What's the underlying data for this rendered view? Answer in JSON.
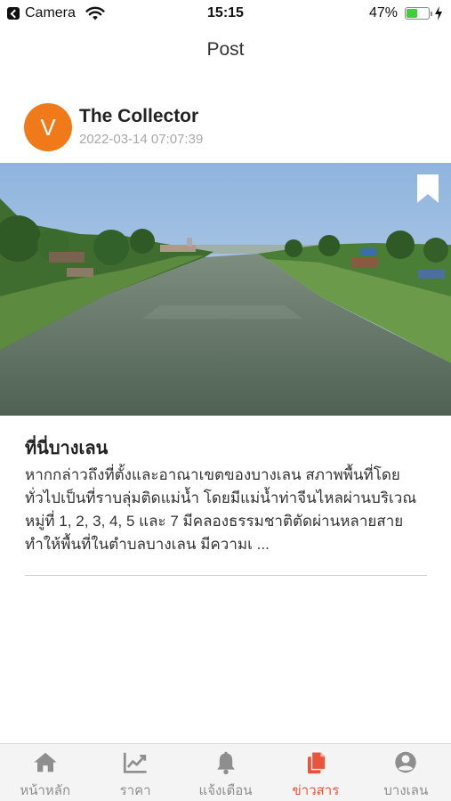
{
  "status_bar": {
    "back_app": "Camera",
    "time": "15:15",
    "battery_percent": "47%",
    "battery_level": 0.47
  },
  "header": {
    "title": "Post"
  },
  "post": {
    "author_initial": "V",
    "author_name": "The Collector",
    "date": "2022-03-14 07:07:39",
    "title": "ที่นี่บางเลน",
    "excerpt": "หากกล่าวถึงที่ตั้งและอาณาเขตของบางเลน สภาพพื้นที่โดยทั่วไปเป็นที่ราบลุ่มติดแม่น้ำ โดยมีแม่น้ำท่าจีนไหลผ่านบริเวณหมู่ที่ 1, 2, 3, 4, 5 และ 7 มีคลองธรรมชาติตัดผ่านหลายสายทำให้พื้นที่ในตำบลบางเลน มีความเ ..."
  },
  "tabs": [
    {
      "label": "หน้าหลัก",
      "icon": "home-icon",
      "active": false
    },
    {
      "label": "ราคา",
      "icon": "chart-icon",
      "active": false
    },
    {
      "label": "แจ้งเตือน",
      "icon": "bell-icon",
      "active": false
    },
    {
      "label": "ข่าวสาร",
      "icon": "news-icon",
      "active": true
    },
    {
      "label": "บางเลน",
      "icon": "profile-icon",
      "active": false
    }
  ],
  "colors": {
    "accent": "#e8553c",
    "avatar": "#f07a1a",
    "inactive_tab": "#8e8e8e",
    "battery": "#3ecf3a"
  }
}
